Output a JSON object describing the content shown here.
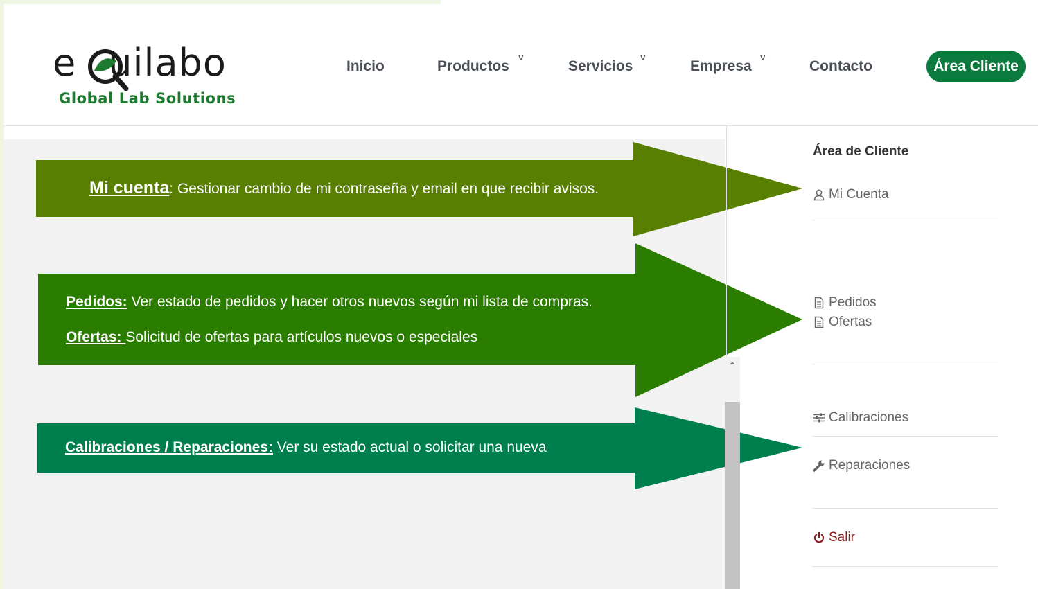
{
  "brand": {
    "name": "eQuilabo",
    "tagline": "Global Lab Solutions",
    "colors": {
      "dark_green": "#1e7a2e",
      "button_green": "#0d7a3d"
    }
  },
  "nav": {
    "items": [
      "Inicio",
      "Productos",
      "Servicios",
      "Empresa",
      "Contacto"
    ],
    "chevron": "˅",
    "cta_label": "Área Cliente"
  },
  "arrows": {
    "cuenta": {
      "key": "Mi cuenta",
      "text": ": Gestionar cambio de mi contraseña y email en que recibir avisos.",
      "color": "#587f00"
    },
    "pedidos": {
      "key": "Pedidos:",
      "text": " Ver estado de pedidos y hacer otros nuevos según mi lista de compras.",
      "color": "#2b7d00"
    },
    "ofertas": {
      "key": "Ofertas: ",
      "text": "Solicitud de ofertas para artículos nuevos o especiales"
    },
    "calibraciones": {
      "key": "Calibraciones / Reparaciones:",
      "text": " Ver su estado actual o solicitar una nueva",
      "color": "#007f4e"
    }
  },
  "sidebar": {
    "title": "Área de Cliente",
    "items": [
      {
        "label": "Mi Cuenta",
        "icon": "user-icon"
      },
      {
        "label": "Pedidos",
        "icon": "document-icon"
      },
      {
        "label": "Ofertas",
        "icon": "document-icon"
      },
      {
        "label": "Calibraciones",
        "icon": "sliders-icon"
      },
      {
        "label": "Reparaciones",
        "icon": "wrench-icon"
      },
      {
        "label": "Salir",
        "icon": "power-icon"
      }
    ]
  }
}
